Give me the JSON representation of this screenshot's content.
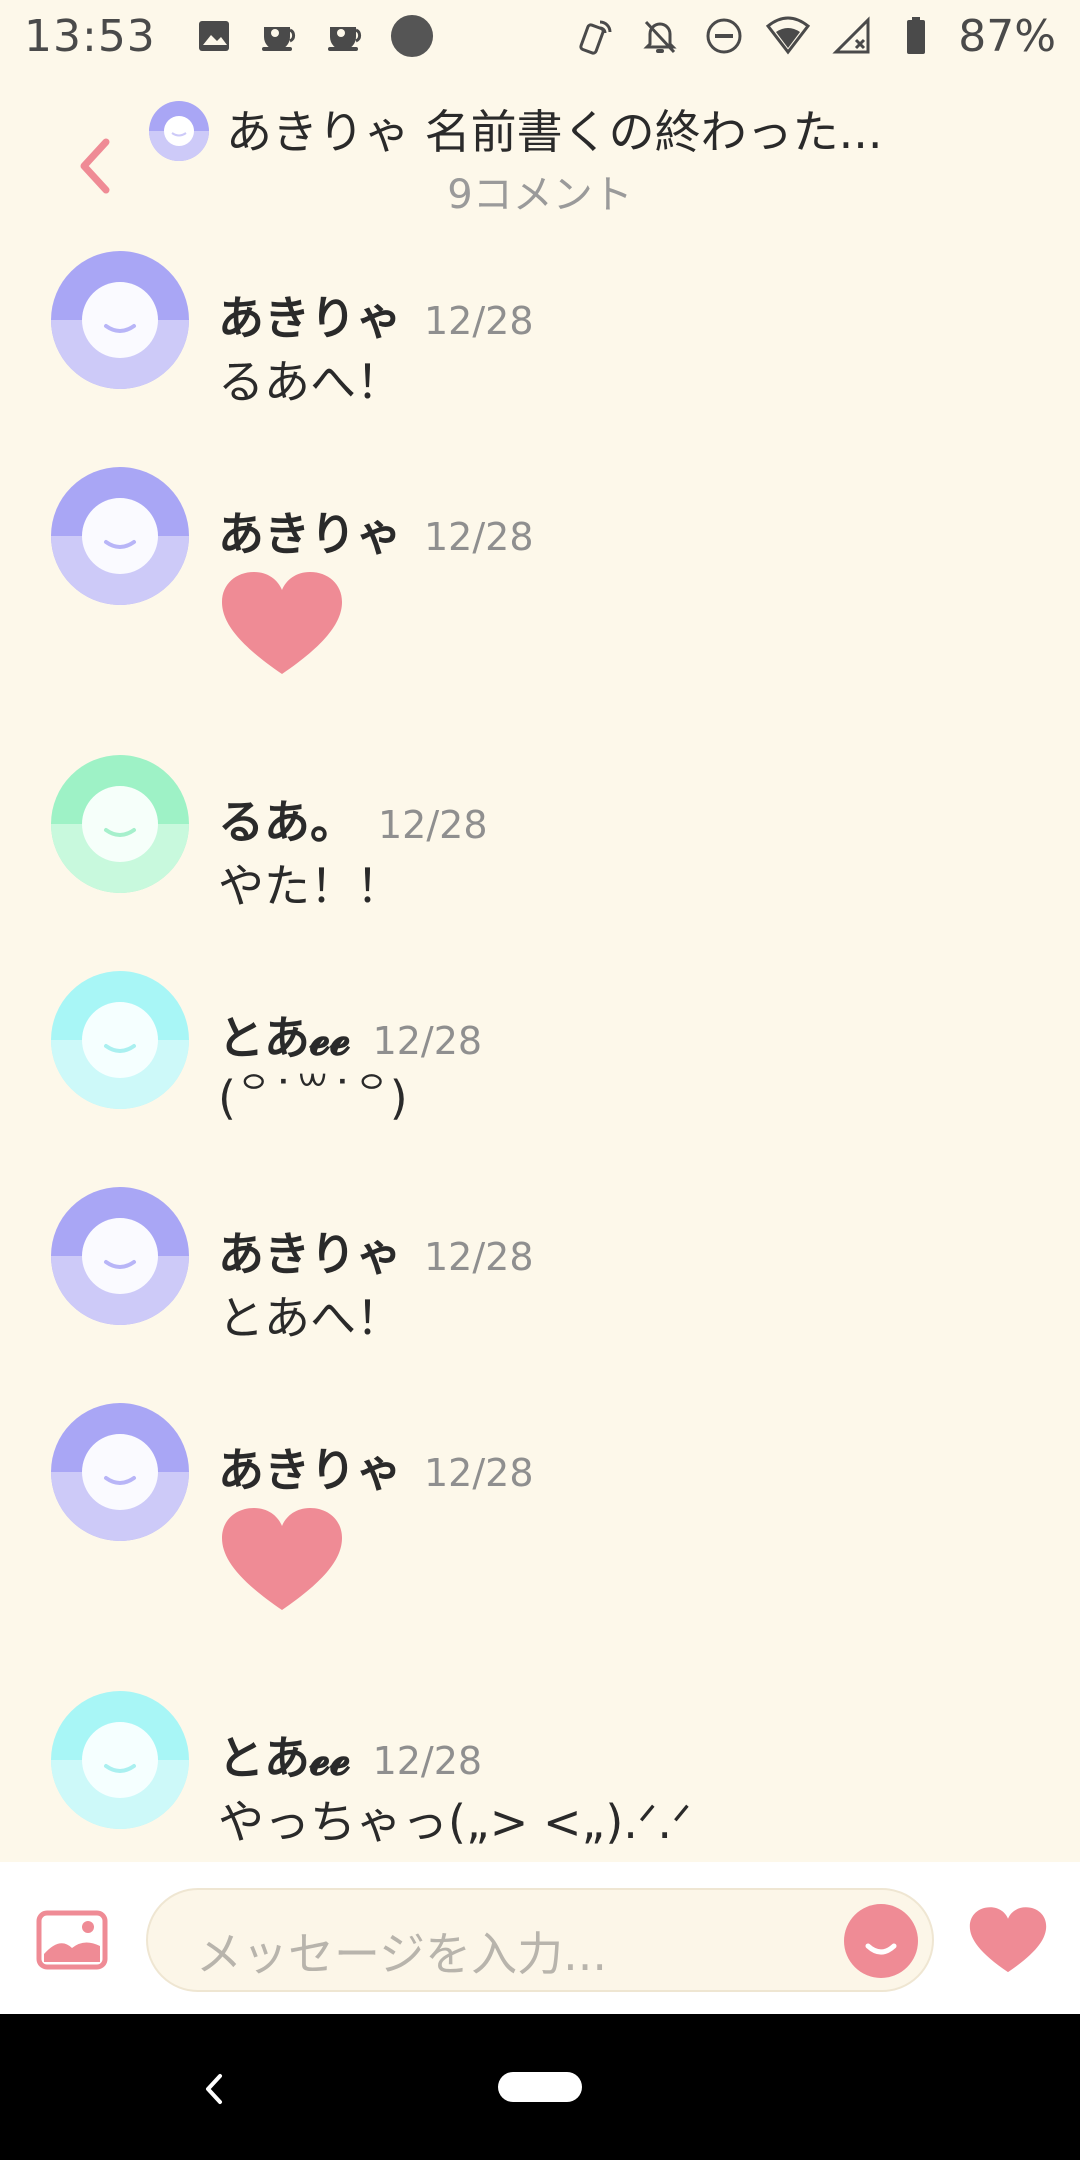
{
  "status_bar": {
    "time": "13:53",
    "battery": "87%",
    "icons_left": [
      "image-icon",
      "cup-icon",
      "cup-icon",
      "dot-icon"
    ],
    "icons_right": [
      "nfc-icon",
      "bell-off-icon",
      "dnd-icon",
      "wifi-icon",
      "signal-icon",
      "battery-icon"
    ]
  },
  "header": {
    "title": "あきりゃ 名前書くの終わった...",
    "subtitle": "9コメント"
  },
  "colors": {
    "background": "#fdf8ea",
    "accent": "#ef8b95",
    "avatar_purple": "#a9a6f5",
    "avatar_green": "#9ef2c6",
    "avatar_cyan": "#a8f6f6"
  },
  "comments": [
    {
      "name": "あきりゃ",
      "date": "12/28",
      "text": "るあへ！",
      "avatar": "purple"
    },
    {
      "name": "あきりゃ",
      "date": "12/28",
      "text": "",
      "heart": true,
      "avatar": "purple"
    },
    {
      "name": "るあ。",
      "date": "12/28",
      "text": "やた！！",
      "avatar": "green"
    },
    {
      "name": "とあ𝓮𝓮",
      "date": "12/28",
      "text": "(꒪˙꒳˙꒪)",
      "avatar": "cyan"
    },
    {
      "name": "あきりゃ",
      "date": "12/28",
      "text": "とあへ！",
      "avatar": "purple"
    },
    {
      "name": "あきりゃ",
      "date": "12/28",
      "text": "",
      "heart": true,
      "avatar": "purple"
    },
    {
      "name": "とあ𝓮𝓮",
      "date": "12/28",
      "text": "やっちゃっ(„> <„).ᐟ.ᐟ",
      "avatar": "cyan"
    }
  ],
  "input": {
    "placeholder": "メッセージを入力..."
  }
}
